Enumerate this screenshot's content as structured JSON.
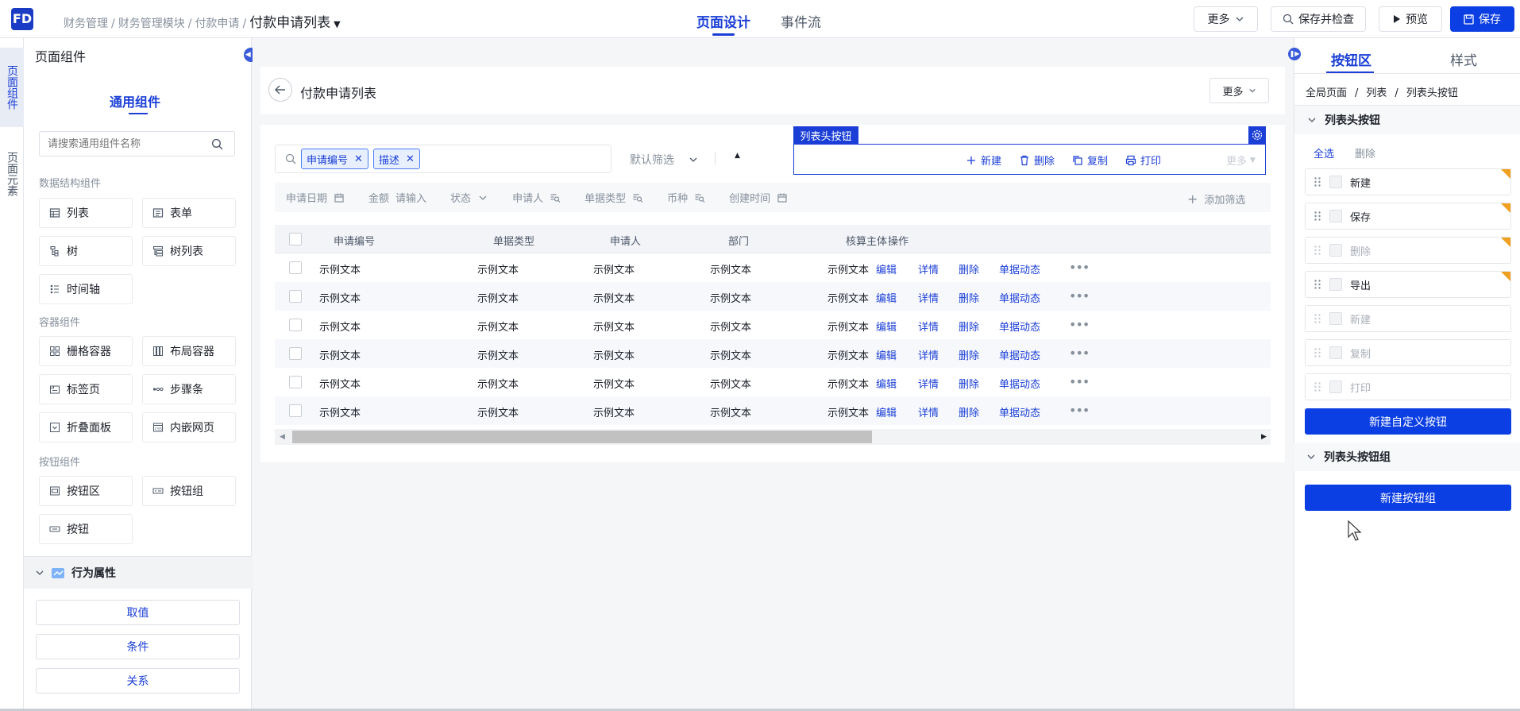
{
  "header": {
    "logo": "FD",
    "breadcrumb": [
      "财务管理",
      "财务管理模块",
      "付款申请"
    ],
    "current_page": "付款申请列表",
    "tabs": [
      {
        "label": "页面设计",
        "active": true
      },
      {
        "label": "事件流",
        "active": false
      }
    ],
    "buttons": {
      "more": "更多",
      "save_check": "保存并检查",
      "preview": "预览",
      "save": "保存"
    }
  },
  "rail": {
    "tabs": [
      {
        "label": "页面组件",
        "active": true
      },
      {
        "label": "页面元素",
        "active": false
      }
    ]
  },
  "left_panel": {
    "title": "页面组件",
    "tab": "通用组件",
    "search_placeholder": "请搜索通用组件名称",
    "sections": [
      {
        "title": "数据结构组件",
        "items": [
          {
            "label": "列表",
            "icon": "table-icon"
          },
          {
            "label": "表单",
            "icon": "form-icon"
          },
          {
            "label": "树",
            "icon": "tree-icon"
          },
          {
            "label": "树列表",
            "icon": "tree-list-icon"
          },
          {
            "label": "时间轴",
            "icon": "timeline-icon"
          }
        ]
      },
      {
        "title": "容器组件",
        "items": [
          {
            "label": "栅格容器",
            "icon": "grid-icon"
          },
          {
            "label": "布局容器",
            "icon": "layout-icon"
          },
          {
            "label": "标签页",
            "icon": "tabs-icon"
          },
          {
            "label": "步骤条",
            "icon": "steps-icon"
          },
          {
            "label": "折叠面板",
            "icon": "collapse-icon"
          },
          {
            "label": "内嵌网页",
            "icon": "iframe-icon"
          }
        ]
      },
      {
        "title": "按钮组件",
        "items": [
          {
            "label": "按钮区",
            "icon": "button-area-icon"
          },
          {
            "label": "按钮组",
            "icon": "button-group-icon"
          },
          {
            "label": "按钮",
            "icon": "button-icon"
          }
        ]
      }
    ],
    "behavior": {
      "title": "行为属性",
      "buttons": [
        "取值",
        "条件",
        "关系"
      ]
    }
  },
  "canvas": {
    "page_title": "付款申请列表",
    "more": "更多",
    "search_tags": [
      "申请编号",
      "描述"
    ],
    "default_filter": "默认筛选",
    "toolbar_label": "列表头按钮",
    "toolbar_buttons": [
      {
        "label": "新建",
        "icon": "plus-icon"
      },
      {
        "label": "删除",
        "icon": "trash-icon"
      },
      {
        "label": "复制",
        "icon": "copy-icon"
      },
      {
        "label": "打印",
        "icon": "printer-icon"
      }
    ],
    "toolbar_more": "更多",
    "filters": [
      {
        "label": "申请日期",
        "icon": "calendar-icon"
      },
      {
        "label": "金额",
        "value": "请输入"
      },
      {
        "label": "状态",
        "icon": "chevron-down-icon"
      },
      {
        "label": "申请人",
        "icon": "search-list-icon"
      },
      {
        "label": "单据类型",
        "icon": "search-list-icon"
      },
      {
        "label": "币种",
        "icon": "search-list-icon"
      },
      {
        "label": "创建时间",
        "icon": "calendar-icon"
      }
    ],
    "add_filter": "添加筛选",
    "table": {
      "columns": [
        "申请编号",
        "单据类型",
        "申请人",
        "部门",
        "核算主体",
        "操作"
      ],
      "rows": [
        [
          "示例文本",
          "示例文本",
          "示例文本",
          "示例文本",
          "示例文本"
        ],
        [
          "示例文本",
          "示例文本",
          "示例文本",
          "示例文本",
          "示例文本"
        ],
        [
          "示例文本",
          "示例文本",
          "示例文本",
          "示例文本",
          "示例文本"
        ],
        [
          "示例文本",
          "示例文本",
          "示例文本",
          "示例文本",
          "示例文本"
        ],
        [
          "示例文本",
          "示例文本",
          "示例文本",
          "示例文本",
          "示例文本"
        ],
        [
          "示例文本",
          "示例文本",
          "示例文本",
          "示例文本",
          "示例文本"
        ]
      ],
      "actions": [
        "编辑",
        "详情",
        "删除",
        "单据动态"
      ]
    }
  },
  "right_panel": {
    "tabs": [
      {
        "label": "按钮区",
        "active": true
      },
      {
        "label": "样式",
        "active": false
      }
    ],
    "breadcrumb": [
      "全局页面",
      "列表",
      "列表头按钮"
    ],
    "group1": {
      "title": "列表头按钮",
      "select_all": "全选",
      "delete": "删除",
      "items": [
        {
          "label": "新建",
          "enabled": true
        },
        {
          "label": "保存",
          "enabled": true
        },
        {
          "label": "删除",
          "enabled": false
        },
        {
          "label": "导出",
          "enabled": true
        },
        {
          "label": "新建",
          "enabled": false
        },
        {
          "label": "复制",
          "enabled": false
        },
        {
          "label": "打印",
          "enabled": false
        }
      ],
      "new_custom": "新建自定义按钮"
    },
    "group2": {
      "title": "列表头按钮组",
      "new_group": "新建按钮组"
    }
  },
  "colors": {
    "primary": "#0b3ee3",
    "link": "#1a3ed6",
    "warning_corner": "#f0a020"
  }
}
